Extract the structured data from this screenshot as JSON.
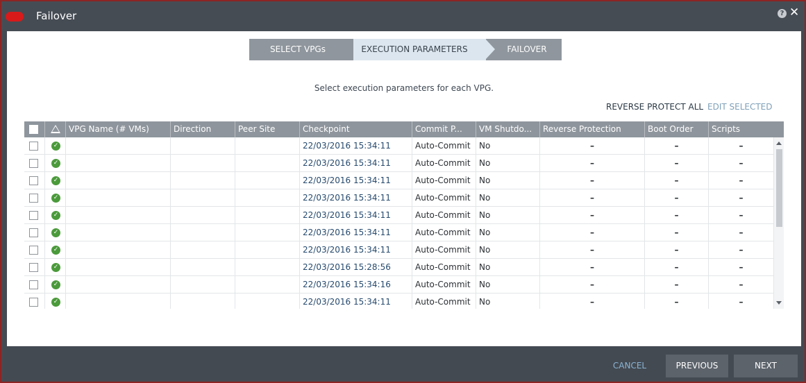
{
  "window": {
    "title": "Failover",
    "help_label": "?",
    "close_label": "✕"
  },
  "stepper": {
    "steps": [
      "SELECT VPGs",
      "EXECUTION PARAMETERS",
      "FAILOVER"
    ],
    "active_index": 1
  },
  "instruction": "Select execution parameters for each VPG.",
  "actions": {
    "reverse_protect_all": "REVERSE PROTECT ALL",
    "edit_selected": "EDIT SELECTED"
  },
  "table": {
    "columns": [
      "VPG Name (# VMs)",
      "Direction",
      "Peer Site",
      "Checkpoint",
      "Commit P...",
      "VM Shutdo...",
      "Reverse Protection",
      "Boot Order",
      "Scripts"
    ],
    "rows": [
      {
        "vpg_name": "",
        "direction": "",
        "peer_site": "",
        "checkpoint": "22/03/2016 15:34:11",
        "commit": "Auto-Commit",
        "vm_shutdown": "No",
        "reverse_protection": "–",
        "boot_order": "–",
        "scripts": "–"
      },
      {
        "vpg_name": "",
        "direction": "",
        "peer_site": "",
        "checkpoint": "22/03/2016 15:34:11",
        "commit": "Auto-Commit",
        "vm_shutdown": "No",
        "reverse_protection": "–",
        "boot_order": "–",
        "scripts": "–"
      },
      {
        "vpg_name": "",
        "direction": "",
        "peer_site": "",
        "checkpoint": "22/03/2016 15:34:11",
        "commit": "Auto-Commit",
        "vm_shutdown": "No",
        "reverse_protection": "–",
        "boot_order": "–",
        "scripts": "–"
      },
      {
        "vpg_name": "",
        "direction": "",
        "peer_site": "",
        "checkpoint": "22/03/2016 15:34:11",
        "commit": "Auto-Commit",
        "vm_shutdown": "No",
        "reverse_protection": "–",
        "boot_order": "–",
        "scripts": "–"
      },
      {
        "vpg_name": "",
        "direction": "",
        "peer_site": "",
        "checkpoint": "22/03/2016 15:34:11",
        "commit": "Auto-Commit",
        "vm_shutdown": "No",
        "reverse_protection": "–",
        "boot_order": "–",
        "scripts": "–"
      },
      {
        "vpg_name": "",
        "direction": "",
        "peer_site": "",
        "checkpoint": "22/03/2016 15:34:11",
        "commit": "Auto-Commit",
        "vm_shutdown": "No",
        "reverse_protection": "–",
        "boot_order": "–",
        "scripts": "–"
      },
      {
        "vpg_name": "",
        "direction": "",
        "peer_site": "",
        "checkpoint": "22/03/2016 15:34:11",
        "commit": "Auto-Commit",
        "vm_shutdown": "No",
        "reverse_protection": "–",
        "boot_order": "–",
        "scripts": "–"
      },
      {
        "vpg_name": "",
        "direction": "",
        "peer_site": "",
        "checkpoint": "22/03/2016 15:28:56",
        "commit": "Auto-Commit",
        "vm_shutdown": "No",
        "reverse_protection": "–",
        "boot_order": "–",
        "scripts": "–"
      },
      {
        "vpg_name": "",
        "direction": "",
        "peer_site": "",
        "checkpoint": "22/03/2016 15:34:16",
        "commit": "Auto-Commit",
        "vm_shutdown": "No",
        "reverse_protection": "–",
        "boot_order": "–",
        "scripts": "–"
      },
      {
        "vpg_name": "",
        "direction": "",
        "peer_site": "",
        "checkpoint": "22/03/2016 15:34:11",
        "commit": "Auto-Commit",
        "vm_shutdown": "No",
        "reverse_protection": "–",
        "boot_order": "–",
        "scripts": "–"
      }
    ],
    "status_icon": "check-circle-icon"
  },
  "footer": {
    "cancel": "CANCEL",
    "previous": "PREVIOUS",
    "next": "NEXT"
  },
  "colors": {
    "title_bar": "#464c54",
    "header": "#8e959c",
    "active_step": "#dce6ee",
    "ok_green": "#4b9a3b",
    "brand_red": "#d91a1a"
  }
}
